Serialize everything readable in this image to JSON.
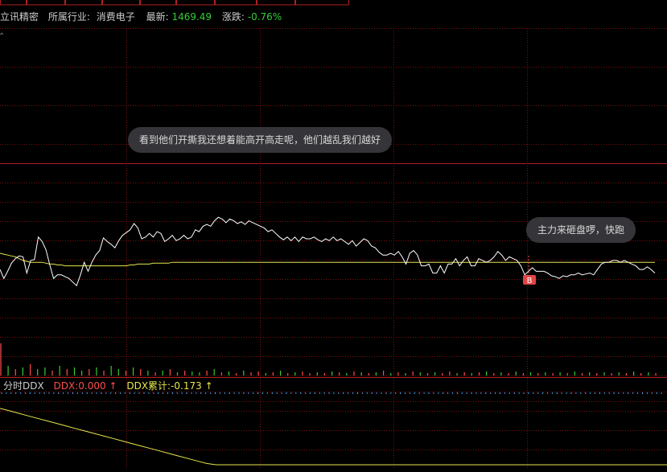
{
  "tabs": [
    "",
    "",
    "",
    "",
    "",
    "",
    "",
    "",
    ""
  ],
  "stock_info": {
    "name": "立讯精密",
    "industry_label": "所属行业:",
    "industry": "消费电子",
    "latest_label": "最新:",
    "latest": "1469.49",
    "change_label": "涨跌:",
    "change": "-0.76%"
  },
  "comments": [
    "看到他们开撕我还想着能高开高走呢，他们越乱我们越好",
    "主力来砸盘啰，快跑"
  ],
  "buy_marker": "B",
  "ddx": {
    "panel_label": "分时DDX",
    "ddx_label": "DDX:0.000",
    "ddx_arrow": "↑",
    "cumulative_label": "DDX累计:-0.173",
    "cumulative_arrow": "↑"
  },
  "colors": {
    "background": "#000000",
    "grid": "#7a1010",
    "price_line": "#ffffff",
    "avg_line": "#e6e64d",
    "up": "#ff4d4d",
    "down": "#33cc33",
    "ddx_cumulative": "#e6e64d",
    "info_text": "#cccccc",
    "tab_border": "#b02020"
  },
  "chart_data": {
    "type": "line",
    "price_series": [
      24,
      14,
      22,
      31,
      36,
      39,
      38,
      20,
      34,
      35,
      60,
      55,
      46,
      29,
      14,
      18,
      18,
      16,
      14,
      10,
      6,
      18,
      32,
      22,
      32,
      40,
      45,
      59,
      55,
      52,
      48,
      56,
      62,
      65,
      68,
      75,
      70,
      58,
      60,
      64,
      60,
      66,
      64,
      55,
      58,
      62,
      56,
      58,
      62,
      58,
      60,
      68,
      66,
      72,
      74,
      72,
      78,
      82,
      80,
      76,
      80,
      78,
      75,
      77,
      74,
      78,
      76,
      74,
      72,
      70,
      66,
      68,
      64,
      60,
      57,
      60,
      56,
      60,
      55,
      60,
      58,
      58,
      60,
      57,
      55,
      58,
      56,
      60,
      56,
      58,
      55,
      52,
      56,
      50,
      54,
      58,
      56,
      50,
      48,
      43,
      40,
      40,
      42,
      40,
      44,
      38,
      30,
      42,
      45,
      40,
      28,
      28,
      30,
      20,
      20,
      28,
      20,
      30,
      30,
      36,
      28,
      34,
      38,
      28,
      28,
      36,
      34,
      32,
      34,
      38,
      44,
      40,
      34,
      38,
      36,
      34,
      28,
      18,
      22,
      26,
      22,
      22,
      22,
      20,
      17,
      16,
      14,
      17,
      16,
      18,
      18,
      20,
      18,
      19,
      20,
      18,
      24,
      30,
      32,
      32,
      34,
      34,
      32,
      34,
      32,
      30,
      28,
      24,
      24,
      27,
      24,
      20
    ],
    "avg_series": [
      42,
      41,
      40,
      39,
      38,
      36,
      34,
      33,
      32,
      32,
      32,
      32,
      31,
      30,
      30,
      29,
      29,
      28,
      28,
      28,
      28,
      28,
      28,
      28,
      28,
      28,
      28,
      28,
      28,
      28,
      28,
      28,
      28,
      28,
      29,
      29,
      30,
      30,
      30,
      30,
      31,
      31,
      31,
      31,
      31,
      32,
      32,
      32,
      32,
      32,
      32,
      32,
      32,
      32,
      32,
      32,
      32,
      32,
      32,
      32,
      32,
      32,
      32,
      32,
      32,
      32,
      32,
      32,
      32,
      32,
      32,
      32,
      32,
      32,
      32,
      32,
      32,
      32,
      32,
      32,
      32,
      32,
      32,
      32,
      32,
      32,
      32,
      32,
      32,
      32,
      32,
      32,
      32,
      32,
      32,
      32,
      32,
      32,
      32,
      32,
      32,
      32,
      32,
      32,
      32,
      32,
      32,
      32,
      32,
      32,
      32,
      32,
      32,
      32,
      32,
      32,
      32,
      32,
      32,
      32,
      32,
      32,
      32,
      32,
      32,
      32,
      32,
      32,
      32,
      32,
      32,
      32,
      32,
      32,
      32,
      32,
      32,
      32,
      32,
      32,
      32,
      32,
      32,
      32,
      32,
      32,
      32,
      32,
      32,
      32,
      32,
      32,
      32,
      32,
      32,
      32,
      32,
      32,
      32,
      32,
      32,
      32,
      32,
      32,
      32,
      32,
      32,
      32,
      32,
      32,
      32,
      32
    ],
    "ddx_cumulative_series": [
      10,
      14,
      18,
      22,
      26,
      30,
      34,
      38,
      42,
      46,
      50,
      54,
      58,
      62,
      66,
      70,
      74,
      78,
      82,
      86,
      90,
      94,
      98,
      100,
      100,
      100,
      100,
      100,
      100,
      100,
      100,
      100,
      100,
      100,
      100,
      100,
      100,
      100,
      100,
      100,
      100,
      100,
      100,
      100,
      100,
      100,
      100,
      100,
      100,
      100,
      100,
      100,
      100,
      100,
      100,
      100,
      100,
      100,
      100,
      100,
      100,
      100,
      100,
      100,
      100,
      100,
      100,
      100,
      100,
      100,
      100,
      100
    ],
    "volume_bars": [
      40,
      12,
      8,
      10,
      14,
      8,
      10,
      6,
      12,
      8,
      10,
      6,
      8,
      10,
      6,
      12,
      8,
      6,
      10,
      8,
      6,
      4,
      6,
      8,
      4,
      6,
      5,
      4,
      6,
      8,
      4,
      5,
      3,
      6,
      4,
      5,
      3,
      4,
      6,
      3,
      4,
      5,
      3,
      4,
      3,
      5,
      4,
      3,
      5,
      4,
      3,
      4,
      6,
      3,
      4,
      3,
      5,
      4,
      3,
      4,
      3,
      5,
      3,
      4,
      3,
      4,
      5,
      3,
      4,
      3,
      5,
      3,
      4,
      3,
      4,
      3,
      4,
      3,
      5,
      3,
      4,
      3,
      4,
      3,
      4,
      3,
      5,
      3,
      4,
      3
    ],
    "volume_colors": [
      "up",
      "down",
      "up",
      "down",
      "up",
      "down",
      "down",
      "up",
      "down",
      "up",
      "down",
      "down",
      "up",
      "down",
      "up",
      "down",
      "down",
      "up",
      "down",
      "up",
      "down",
      "up",
      "down",
      "up",
      "down",
      "up",
      "down",
      "down",
      "up",
      "down",
      "up",
      "down",
      "up",
      "down",
      "up",
      "up",
      "down",
      "up",
      "down",
      "up",
      "down",
      "up",
      "up",
      "down",
      "up",
      "down",
      "up",
      "down",
      "up",
      "down",
      "up",
      "down",
      "up",
      "down",
      "up",
      "down",
      "up",
      "down",
      "up",
      "down",
      "up",
      "up",
      "down",
      "up",
      "down",
      "up",
      "down",
      "up",
      "down",
      "up",
      "down",
      "up",
      "down",
      "up",
      "down",
      "up",
      "down",
      "up",
      "down",
      "up",
      "down",
      "up",
      "down",
      "up",
      "down",
      "up",
      "down",
      "up",
      "down",
      "up"
    ]
  }
}
